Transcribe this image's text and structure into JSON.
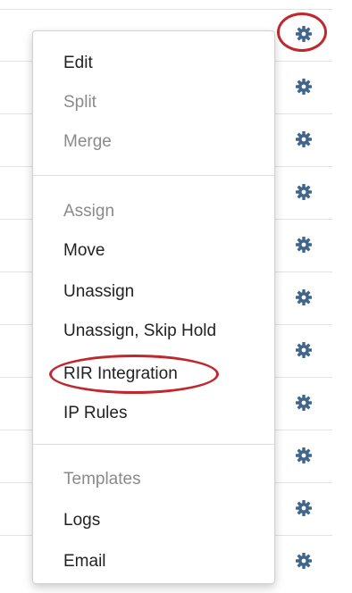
{
  "menu": {
    "sections": [
      {
        "items": [
          {
            "label": "Edit",
            "enabled": true
          },
          {
            "label": "Split",
            "enabled": false
          },
          {
            "label": "Merge",
            "enabled": false
          }
        ]
      },
      {
        "items": [
          {
            "label": "Assign",
            "enabled": false
          },
          {
            "label": "Move",
            "enabled": true
          },
          {
            "label": "Unassign",
            "enabled": true
          },
          {
            "label": "Unassign, Skip Hold",
            "enabled": true
          },
          {
            "label": "RIR Integration",
            "enabled": true,
            "highlighted": true
          },
          {
            "label": "IP Rules",
            "enabled": true
          }
        ]
      },
      {
        "items": [
          {
            "label": "Templates",
            "enabled": false
          },
          {
            "label": "Logs",
            "enabled": true
          },
          {
            "label": "Email",
            "enabled": true
          }
        ]
      }
    ]
  },
  "gear_icon": "gear-icon",
  "gear_row_count": 11,
  "colors": {
    "gear": "#40668c",
    "highlight_circle": "#c0282d",
    "enabled_text": "#222222",
    "disabled_text": "#8a8a8a"
  }
}
